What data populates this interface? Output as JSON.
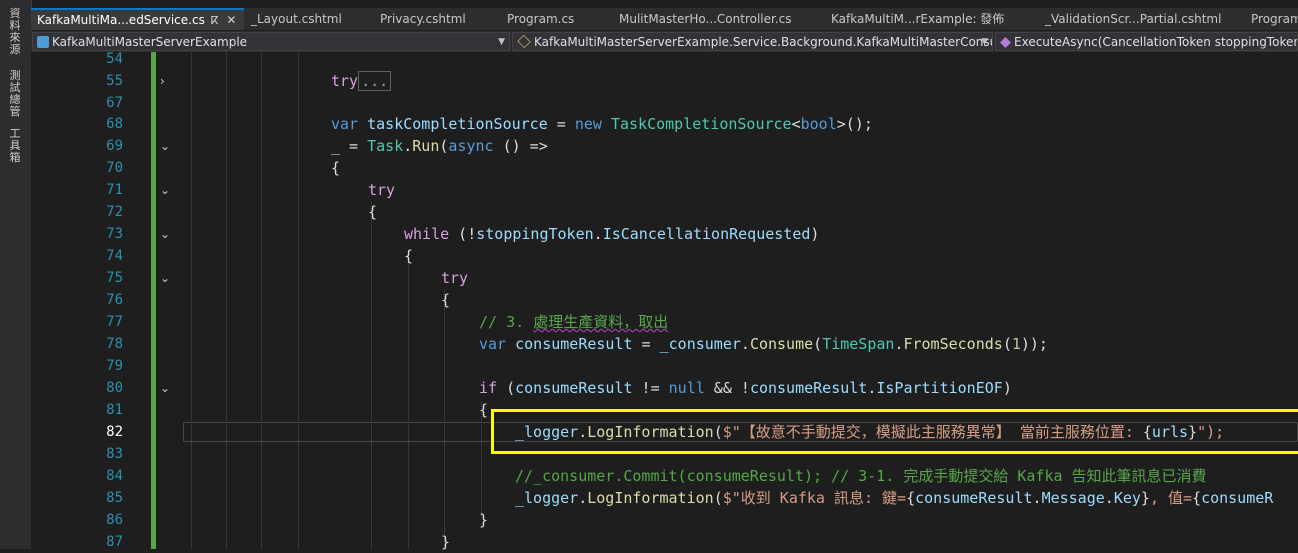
{
  "left_rail": {
    "items": [
      "資料來源",
      "測試總管",
      "工具箱"
    ]
  },
  "tabs": [
    {
      "label": "KafkaMultiMa...edService.cs",
      "active": true,
      "pin": "ⴽ",
      "close": "✕"
    },
    {
      "label": "_Layout.cshtml"
    },
    {
      "label": "Privacy.cshtml"
    },
    {
      "label": "Program.cs"
    },
    {
      "label": "MulitMasterHo...Controller.cs"
    },
    {
      "label": "KafkaMultiM...rExample: 發佈"
    },
    {
      "label": "_ValidationScr...Partial.cshtml"
    },
    {
      "label": "Program.c"
    }
  ],
  "navbar": {
    "project": "KafkaMultiMasterServerExample",
    "class": "KafkaMultiMasterServerExample.Service.Background.KafkaMultiMasterConsum",
    "method": "ExecuteAsync(CancellationToken stoppingToken)"
  },
  "line_numbers": [
    "54",
    "55",
    "67",
    "68",
    "69",
    "70",
    "71",
    "72",
    "73",
    "74",
    "75",
    "76",
    "77",
    "78",
    "79",
    "80",
    "81",
    "82",
    "83",
    "84",
    "85",
    "86",
    "87"
  ],
  "current_line": "82",
  "code": {
    "l55_try": "try",
    "l55_collapsed": "...",
    "l68": {
      "var": "var",
      "name": "taskCompletionSource",
      "eq": " = ",
      "new": "new",
      "type": "TaskCompletionSource",
      "lt": "<",
      "bool": "bool",
      "rest": ">();"
    },
    "l69": {
      "discard": "_",
      "eq": " = ",
      "task": "Task",
      "dot": ".",
      "run": "Run",
      "open": "(",
      "async": "async",
      "rest": " () =>"
    },
    "l70": "{",
    "l71": "try",
    "l72": "{",
    "l73": {
      "while": "while",
      "open": " (!",
      "token": "stoppingToken",
      "dot": ".",
      "prop": "IsCancellationRequested",
      "close": ")"
    },
    "l74": "{",
    "l75": "try",
    "l76": "{",
    "l77": {
      "prefix": "// 3. ",
      "cjk": "處理生產資料，取出"
    },
    "l78": {
      "var": "var",
      "name": "consumeResult",
      "eq": " = ",
      "field": "_consumer",
      "dot": ".",
      "method": "Consume",
      "open": "(",
      "type": "TimeSpan",
      "dot2": ".",
      "method2": "FromSeconds",
      "open2": "(",
      "num": "1",
      "close": "));"
    },
    "l80": {
      "if": "if",
      "open": " (",
      "v1": "consumeResult",
      "neq": " != ",
      "null": "null",
      "and": " && !",
      "v2": "consumeResult",
      "dot": ".",
      "prop": "IsPartitionEOF",
      "close": ")"
    },
    "l81": "{",
    "l82": {
      "field": "_logger",
      "dot": ".",
      "method": "LogInformation",
      "open": "(",
      "dollar": "$\"",
      "cjk": "【故意不手動提交，模擬此主服務異常】 當前主服務位置: ",
      "interp_open": "{",
      "interp": "urls",
      "interp_close": "}",
      "end": "\");"
    },
    "l84": {
      "comment": "//_consumer.Commit(consumeResult); // 3-1. 完成手動提交給 Kafka 告知此筆訊息已消費"
    },
    "l85": {
      "field": "_logger",
      "dot": ".",
      "method": "LogInformation",
      "open": "(",
      "dollar": "$\"",
      "cjk": "收到 Kafka 訊息: 鍵=",
      "io": "{",
      "v": "consumeResult",
      "dot2": ".",
      "p1": "Message",
      "dot3": ".",
      "p2": "Key",
      "ic": "}",
      "mid": ", 值=",
      "io2": "{",
      "v2": "consumeR"
    },
    "l86": "}",
    "l87": "}"
  },
  "colors": {
    "keyword": "#569cd6",
    "control": "#d8a0df",
    "type": "#4ec9b0",
    "method": "#dcdcaa",
    "variable": "#9cdcfe",
    "comment": "#57a64a",
    "string": "#d69d85",
    "highlight": "#ffff00"
  }
}
